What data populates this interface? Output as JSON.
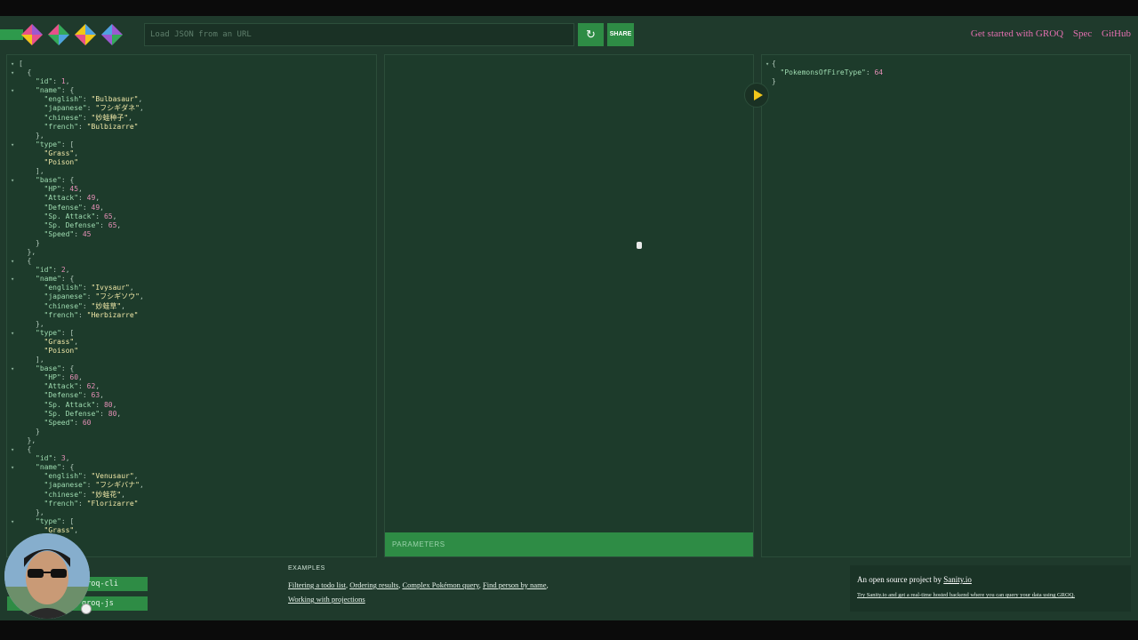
{
  "header": {
    "url_placeholder": "Load JSON from an URL",
    "reload_icon": "↻",
    "share_label": "SHARE",
    "nav": [
      "Get started with GROQ",
      "Spec",
      "GitHub"
    ]
  },
  "logo": {
    "colors": [
      "#e8508b",
      "#f2c71a",
      "#35a95a",
      "#4fa3e0",
      "#9b59d0"
    ]
  },
  "left_panel": {
    "json_lines": [
      {
        "i": 0,
        "t": 1,
        "parts": [
          [
            "p",
            "["
          ]
        ]
      },
      {
        "i": 1,
        "t": 1,
        "parts": [
          [
            "p",
            "{"
          ]
        ]
      },
      {
        "i": 2,
        "parts": [
          [
            "k",
            "\"id\""
          ],
          [
            "p",
            ": "
          ],
          [
            "n",
            "1"
          ],
          [
            "p",
            ","
          ]
        ]
      },
      {
        "i": 2,
        "t": 1,
        "parts": [
          [
            "k",
            "\"name\""
          ],
          [
            "p",
            ": {"
          ]
        ]
      },
      {
        "i": 3,
        "parts": [
          [
            "k",
            "\"english\""
          ],
          [
            "p",
            ": "
          ],
          [
            "s",
            "\"Bulbasaur\""
          ],
          [
            "p",
            ","
          ]
        ]
      },
      {
        "i": 3,
        "parts": [
          [
            "k",
            "\"japanese\""
          ],
          [
            "p",
            ": "
          ],
          [
            "s",
            "\"フシギダネ\""
          ],
          [
            "p",
            ","
          ]
        ]
      },
      {
        "i": 3,
        "parts": [
          [
            "k",
            "\"chinese\""
          ],
          [
            "p",
            ": "
          ],
          [
            "s",
            "\"妙蛙种子\""
          ],
          [
            "p",
            ","
          ]
        ]
      },
      {
        "i": 3,
        "parts": [
          [
            "k",
            "\"french\""
          ],
          [
            "p",
            ": "
          ],
          [
            "s",
            "\"Bulbizarre\""
          ]
        ]
      },
      {
        "i": 2,
        "parts": [
          [
            "p",
            "},"
          ]
        ]
      },
      {
        "i": 2,
        "t": 1,
        "parts": [
          [
            "k",
            "\"type\""
          ],
          [
            "p",
            ": ["
          ]
        ]
      },
      {
        "i": 3,
        "parts": [
          [
            "s",
            "\"Grass\""
          ],
          [
            "p",
            ","
          ]
        ]
      },
      {
        "i": 3,
        "parts": [
          [
            "s",
            "\"Poison\""
          ]
        ]
      },
      {
        "i": 2,
        "parts": [
          [
            "p",
            "],"
          ]
        ]
      },
      {
        "i": 2,
        "t": 1,
        "parts": [
          [
            "k",
            "\"base\""
          ],
          [
            "p",
            ": {"
          ]
        ]
      },
      {
        "i": 3,
        "parts": [
          [
            "k",
            "\"HP\""
          ],
          [
            "p",
            ": "
          ],
          [
            "n",
            "45"
          ],
          [
            "p",
            ","
          ]
        ]
      },
      {
        "i": 3,
        "parts": [
          [
            "k",
            "\"Attack\""
          ],
          [
            "p",
            ": "
          ],
          [
            "n",
            "49"
          ],
          [
            "p",
            ","
          ]
        ]
      },
      {
        "i": 3,
        "parts": [
          [
            "k",
            "\"Defense\""
          ],
          [
            "p",
            ": "
          ],
          [
            "n",
            "49"
          ],
          [
            "p",
            ","
          ]
        ]
      },
      {
        "i": 3,
        "parts": [
          [
            "k",
            "\"Sp. Attack\""
          ],
          [
            "p",
            ": "
          ],
          [
            "n",
            "65"
          ],
          [
            "p",
            ","
          ]
        ]
      },
      {
        "i": 3,
        "parts": [
          [
            "k",
            "\"Sp. Defense\""
          ],
          [
            "p",
            ": "
          ],
          [
            "n",
            "65"
          ],
          [
            "p",
            ","
          ]
        ]
      },
      {
        "i": 3,
        "parts": [
          [
            "k",
            "\"Speed\""
          ],
          [
            "p",
            ": "
          ],
          [
            "n",
            "45"
          ]
        ]
      },
      {
        "i": 2,
        "parts": [
          [
            "p",
            "}"
          ]
        ]
      },
      {
        "i": 1,
        "parts": [
          [
            "p",
            "},"
          ]
        ]
      },
      {
        "i": 1,
        "t": 1,
        "parts": [
          [
            "p",
            "{"
          ]
        ]
      },
      {
        "i": 2,
        "parts": [
          [
            "k",
            "\"id\""
          ],
          [
            "p",
            ": "
          ],
          [
            "n",
            "2"
          ],
          [
            "p",
            ","
          ]
        ]
      },
      {
        "i": 2,
        "t": 1,
        "parts": [
          [
            "k",
            "\"name\""
          ],
          [
            "p",
            ": {"
          ]
        ]
      },
      {
        "i": 3,
        "parts": [
          [
            "k",
            "\"english\""
          ],
          [
            "p",
            ": "
          ],
          [
            "s",
            "\"Ivysaur\""
          ],
          [
            "p",
            ","
          ]
        ]
      },
      {
        "i": 3,
        "parts": [
          [
            "k",
            "\"japanese\""
          ],
          [
            "p",
            ": "
          ],
          [
            "s",
            "\"フシギソウ\""
          ],
          [
            "p",
            ","
          ]
        ]
      },
      {
        "i": 3,
        "parts": [
          [
            "k",
            "\"chinese\""
          ],
          [
            "p",
            ": "
          ],
          [
            "s",
            "\"妙蛙草\""
          ],
          [
            "p",
            ","
          ]
        ]
      },
      {
        "i": 3,
        "parts": [
          [
            "k",
            "\"french\""
          ],
          [
            "p",
            ": "
          ],
          [
            "s",
            "\"Herbizarre\""
          ]
        ]
      },
      {
        "i": 2,
        "parts": [
          [
            "p",
            "},"
          ]
        ]
      },
      {
        "i": 2,
        "t": 1,
        "parts": [
          [
            "k",
            "\"type\""
          ],
          [
            "p",
            ": ["
          ]
        ]
      },
      {
        "i": 3,
        "parts": [
          [
            "s",
            "\"Grass\""
          ],
          [
            "p",
            ","
          ]
        ]
      },
      {
        "i": 3,
        "parts": [
          [
            "s",
            "\"Poison\""
          ]
        ]
      },
      {
        "i": 2,
        "parts": [
          [
            "p",
            "],"
          ]
        ]
      },
      {
        "i": 2,
        "t": 1,
        "parts": [
          [
            "k",
            "\"base\""
          ],
          [
            "p",
            ": {"
          ]
        ]
      },
      {
        "i": 3,
        "parts": [
          [
            "k",
            "\"HP\""
          ],
          [
            "p",
            ": "
          ],
          [
            "n",
            "60"
          ],
          [
            "p",
            ","
          ]
        ]
      },
      {
        "i": 3,
        "parts": [
          [
            "k",
            "\"Attack\""
          ],
          [
            "p",
            ": "
          ],
          [
            "n",
            "62"
          ],
          [
            "p",
            ","
          ]
        ]
      },
      {
        "i": 3,
        "parts": [
          [
            "k",
            "\"Defense\""
          ],
          [
            "p",
            ": "
          ],
          [
            "n",
            "63"
          ],
          [
            "p",
            ","
          ]
        ]
      },
      {
        "i": 3,
        "parts": [
          [
            "k",
            "\"Sp. Attack\""
          ],
          [
            "p",
            ": "
          ],
          [
            "n",
            "80"
          ],
          [
            "p",
            ","
          ]
        ]
      },
      {
        "i": 3,
        "parts": [
          [
            "k",
            "\"Sp. Defense\""
          ],
          [
            "p",
            ": "
          ],
          [
            "n",
            "80"
          ],
          [
            "p",
            ","
          ]
        ]
      },
      {
        "i": 3,
        "parts": [
          [
            "k",
            "\"Speed\""
          ],
          [
            "p",
            ": "
          ],
          [
            "n",
            "60"
          ]
        ]
      },
      {
        "i": 2,
        "parts": [
          [
            "p",
            "}"
          ]
        ]
      },
      {
        "i": 1,
        "parts": [
          [
            "p",
            "},"
          ]
        ]
      },
      {
        "i": 1,
        "t": 1,
        "parts": [
          [
            "p",
            "{"
          ]
        ]
      },
      {
        "i": 2,
        "parts": [
          [
            "k",
            "\"id\""
          ],
          [
            "p",
            ": "
          ],
          [
            "n",
            "3"
          ],
          [
            "p",
            ","
          ]
        ]
      },
      {
        "i": 2,
        "t": 1,
        "parts": [
          [
            "k",
            "\"name\""
          ],
          [
            "p",
            ": {"
          ]
        ]
      },
      {
        "i": 3,
        "parts": [
          [
            "k",
            "\"english\""
          ],
          [
            "p",
            ": "
          ],
          [
            "s",
            "\"Venusaur\""
          ],
          [
            "p",
            ","
          ]
        ]
      },
      {
        "i": 3,
        "parts": [
          [
            "k",
            "\"japanese\""
          ],
          [
            "p",
            ": "
          ],
          [
            "s",
            "\"フシギバナ\""
          ],
          [
            "p",
            ","
          ]
        ]
      },
      {
        "i": 3,
        "parts": [
          [
            "k",
            "\"chinese\""
          ],
          [
            "p",
            ": "
          ],
          [
            "s",
            "\"妙蛙花\""
          ],
          [
            "p",
            ","
          ]
        ]
      },
      {
        "i": 3,
        "parts": [
          [
            "k",
            "\"french\""
          ],
          [
            "p",
            ": "
          ],
          [
            "s",
            "\"Florizarre\""
          ]
        ]
      },
      {
        "i": 2,
        "parts": [
          [
            "p",
            "},"
          ]
        ]
      },
      {
        "i": 2,
        "t": 1,
        "parts": [
          [
            "k",
            "\"type\""
          ],
          [
            "p",
            ": ["
          ]
        ]
      },
      {
        "i": 3,
        "parts": [
          [
            "s",
            "\"Grass\""
          ],
          [
            "p",
            ","
          ]
        ]
      }
    ]
  },
  "middle_panel": {
    "params_label": "PARAMETERS"
  },
  "right_panel": {
    "json_lines": [
      {
        "i": 0,
        "t": 1,
        "parts": [
          [
            "p",
            "{"
          ]
        ]
      },
      {
        "i": 1,
        "parts": [
          [
            "k",
            "\"PokemonsOfFireType\""
          ],
          [
            "p",
            ": "
          ],
          [
            "n",
            "64"
          ]
        ]
      },
      {
        "i": 0,
        "parts": [
          [
            "p",
            "}"
          ]
        ]
      }
    ]
  },
  "footer": {
    "packages": [
      "groq-cli",
      "groq-js"
    ],
    "examples_title": "EXAMPLES",
    "examples": [
      "Filtering a todo list",
      "Ordering results",
      "Complex Pokémon query",
      "Find person by name",
      "Working with projections"
    ],
    "sanity_prefix": "An open source project by ",
    "sanity_link": "Sanity.io",
    "sanity_cta": "Try Sanity.io and get a real-time hosted backend where you can query your data using GROQ."
  }
}
